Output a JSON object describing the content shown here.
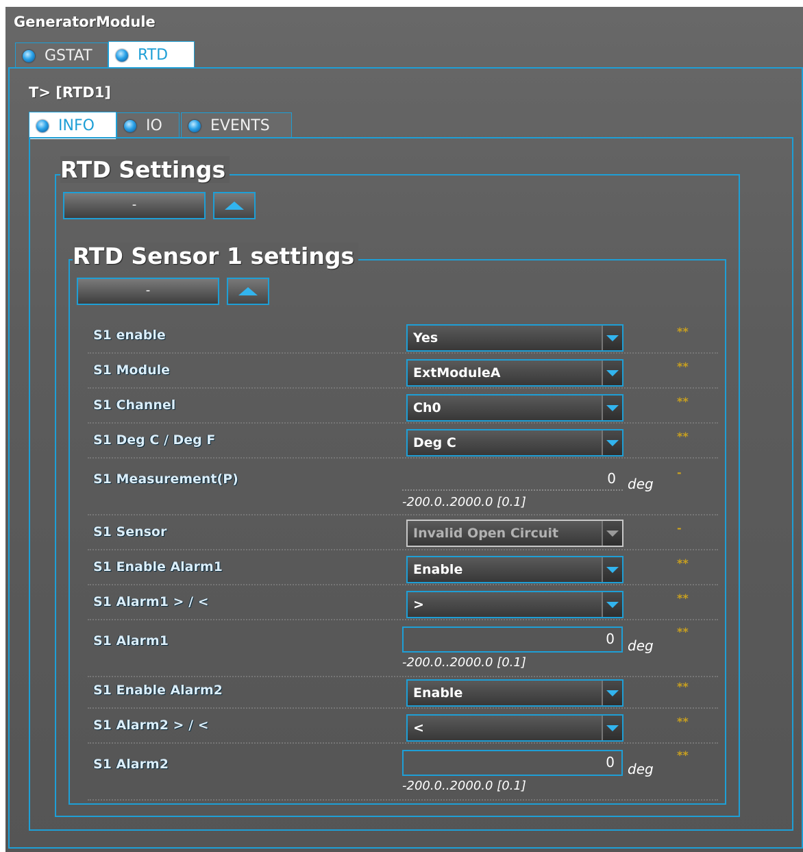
{
  "app": {
    "title": "GeneratorModule"
  },
  "main_tabs": [
    {
      "label": "GSTAT"
    },
    {
      "label": "RTD"
    }
  ],
  "breadcrumb": "T> [RTD1]",
  "sub_tabs": [
    {
      "label": "INFO"
    },
    {
      "label": "IO"
    },
    {
      "label": "EVENTS"
    }
  ],
  "rtd_settings": {
    "title": "RTD Settings",
    "collapse_label": "-"
  },
  "sensor_settings": {
    "title": "RTD Sensor 1 settings",
    "collapse_label": "-"
  },
  "rows": [
    {
      "label": "S1 enable",
      "value": "Yes",
      "flag": "**"
    },
    {
      "label": "S1 Module",
      "value": "ExtModuleA",
      "flag": "**"
    },
    {
      "label": "S1 Channel",
      "value": "Ch0",
      "flag": "**"
    },
    {
      "label": "S1 Deg C / Deg F",
      "value": "Deg C",
      "flag": "**"
    },
    {
      "label": "S1 Measurement(P)",
      "value": "0",
      "unit": "deg",
      "range": "-200.0..2000.0 [0.1]",
      "flag": "-"
    },
    {
      "label": "S1 Sensor",
      "value": "Invalid Open Circuit",
      "flag": "-"
    },
    {
      "label": "S1 Enable Alarm1",
      "value": "Enable",
      "flag": "**"
    },
    {
      "label": "S1 Alarm1 > / <",
      "value": ">",
      "flag": "**"
    },
    {
      "label": "S1 Alarm1",
      "value": "0",
      "unit": "deg",
      "range": "-200.0..2000.0 [0.1]",
      "flag": "**"
    },
    {
      "label": "S1 Enable Alarm2",
      "value": "Enable",
      "flag": "**"
    },
    {
      "label": "S1 Alarm2 > / <",
      "value": "<",
      "flag": "**"
    },
    {
      "label": "S1 Alarm2",
      "value": "0",
      "unit": "deg",
      "range": "-200.0..2000.0 [0.1]",
      "flag": "**"
    }
  ],
  "colors": {
    "accent": "#1e9fd6",
    "flag": "#c8a020",
    "panel_bg": "#5e5e5e"
  }
}
